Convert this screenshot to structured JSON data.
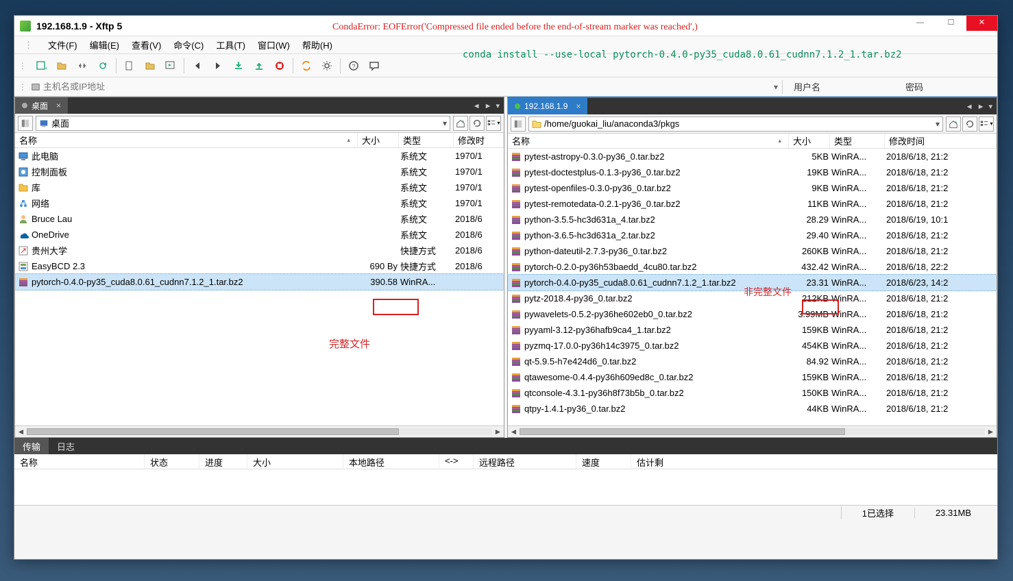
{
  "window": {
    "title": "192.168.1.9   - Xftp 5"
  },
  "menu": [
    "文件(F)",
    "编辑(E)",
    "查看(V)",
    "命令(C)",
    "工具(T)",
    "窗口(W)",
    "帮助(H)"
  ],
  "address": {
    "placeholder": "主机名或IP地址",
    "user_label": "用户名",
    "pass_label": "密码"
  },
  "left_pane": {
    "tab": "桌面",
    "path": "桌面",
    "headers": {
      "name": "名称",
      "size": "大小",
      "type": "类型",
      "mtime": "修改时"
    },
    "rows": [
      {
        "icon": "pc",
        "name": "此电脑",
        "size": "",
        "type": "系统文",
        "mtime": "1970/1"
      },
      {
        "icon": "cp",
        "name": "控制面板",
        "size": "",
        "type": "系统文",
        "mtime": "1970/1"
      },
      {
        "icon": "lib",
        "name": "库",
        "size": "",
        "type": "系统文",
        "mtime": "1970/1"
      },
      {
        "icon": "net",
        "name": "网络",
        "size": "",
        "type": "系统文",
        "mtime": "1970/1"
      },
      {
        "icon": "usr",
        "name": "Bruce Lau",
        "size": "",
        "type": "系统文",
        "mtime": "2018/6"
      },
      {
        "icon": "od",
        "name": "OneDrive",
        "size": "",
        "type": "系统文",
        "mtime": "2018/6"
      },
      {
        "icon": "lnk",
        "name": "贵州大学",
        "size": "",
        "type": "快捷方式",
        "mtime": "2018/6"
      },
      {
        "icon": "bcd",
        "name": "EasyBCD 2.3",
        "size": "690 By",
        "type": "快捷方式",
        "mtime": "2018/6"
      },
      {
        "icon": "rar",
        "name": "pytorch-0.4.0-py35_cuda8.0.61_cudnn7.1.2_1.tar.bz2",
        "size": "390.58",
        "type": "WinRA...",
        "mtime": "",
        "sel": true
      }
    ]
  },
  "right_pane": {
    "tab": "192.168.1.9",
    "path": "/home/guokai_liu/anaconda3/pkgs",
    "headers": {
      "name": "名称",
      "size": "大小",
      "type": "类型",
      "mtime": "修改时间"
    },
    "rows": [
      {
        "name": "pytest-astropy-0.3.0-py36_0.tar.bz2",
        "size": "5KB",
        "type": "WinRA...",
        "mtime": "2018/6/18, 21:2"
      },
      {
        "name": "pytest-doctestplus-0.1.3-py36_0.tar.bz2",
        "size": "19KB",
        "type": "WinRA...",
        "mtime": "2018/6/18, 21:2"
      },
      {
        "name": "pytest-openfiles-0.3.0-py36_0.tar.bz2",
        "size": "9KB",
        "type": "WinRA...",
        "mtime": "2018/6/18, 21:2"
      },
      {
        "name": "pytest-remotedata-0.2.1-py36_0.tar.bz2",
        "size": "11KB",
        "type": "WinRA...",
        "mtime": "2018/6/18, 21:2"
      },
      {
        "name": "python-3.5.5-hc3d631a_4.tar.bz2",
        "size": "28.29",
        "type": "WinRA...",
        "mtime": "2018/6/19, 10:1"
      },
      {
        "name": "python-3.6.5-hc3d631a_2.tar.bz2",
        "size": "29.40",
        "type": "WinRA...",
        "mtime": "2018/6/18, 21:2"
      },
      {
        "name": "python-dateutil-2.7.3-py36_0.tar.bz2",
        "size": "260KB",
        "type": "WinRA...",
        "mtime": "2018/6/18, 21:2"
      },
      {
        "name": "pytorch-0.2.0-py36h53baedd_4cu80.tar.bz2",
        "size": "432.42",
        "type": "WinRA...",
        "mtime": "2018/6/18, 22:2"
      },
      {
        "name": "pytorch-0.4.0-py35_cuda8.0.61_cudnn7.1.2_1.tar.bz2",
        "size": "23.31",
        "type": "WinRA...",
        "mtime": "2018/6/23, 14:2",
        "sel": true
      },
      {
        "name": "pytz-2018.4-py36_0.tar.bz2",
        "size": "212KB",
        "type": "WinRA...",
        "mtime": "2018/6/18, 21:2"
      },
      {
        "name": "pywavelets-0.5.2-py36he602eb0_0.tar.bz2",
        "size": "3.99MB",
        "type": "WinRA...",
        "mtime": "2018/6/18, 21:2"
      },
      {
        "name": "pyyaml-3.12-py36hafb9ca4_1.tar.bz2",
        "size": "159KB",
        "type": "WinRA...",
        "mtime": "2018/6/18, 21:2"
      },
      {
        "name": "pyzmq-17.0.0-py36h14c3975_0.tar.bz2",
        "size": "454KB",
        "type": "WinRA...",
        "mtime": "2018/6/18, 21:2"
      },
      {
        "name": "qt-5.9.5-h7e424d6_0.tar.bz2",
        "size": "84.92",
        "type": "WinRA...",
        "mtime": "2018/6/18, 21:2"
      },
      {
        "name": "qtawesome-0.4.4-py36h609ed8c_0.tar.bz2",
        "size": "159KB",
        "type": "WinRA...",
        "mtime": "2018/6/18, 21:2"
      },
      {
        "name": "qtconsole-4.3.1-py36h8f73b5b_0.tar.bz2",
        "size": "150KB",
        "type": "WinRA...",
        "mtime": "2018/6/18, 21:2"
      },
      {
        "name": "qtpy-1.4.1-py36_0.tar.bz2",
        "size": "44KB",
        "type": "WinRA...",
        "mtime": "2018/6/18, 21:2"
      }
    ]
  },
  "bottom": {
    "tabs": [
      "传输",
      "日志"
    ],
    "cols": [
      "名称",
      "状态",
      "进度",
      "大小",
      "本地路径",
      "<->",
      "远程路径",
      "速度",
      "估计剩"
    ]
  },
  "status": {
    "selected": "1已选择",
    "size": "23.31MB"
  },
  "overlays": {
    "error": "CondaError: EOFError('Compressed file ended before the end-of-stream marker was reached',)",
    "cmd": "conda install --use-local pytorch-0.4.0-py35_cuda8.0.61_cudnn7.1.2_1.tar.bz2",
    "cn1": "完整文件",
    "cn2": "非完整文件"
  }
}
